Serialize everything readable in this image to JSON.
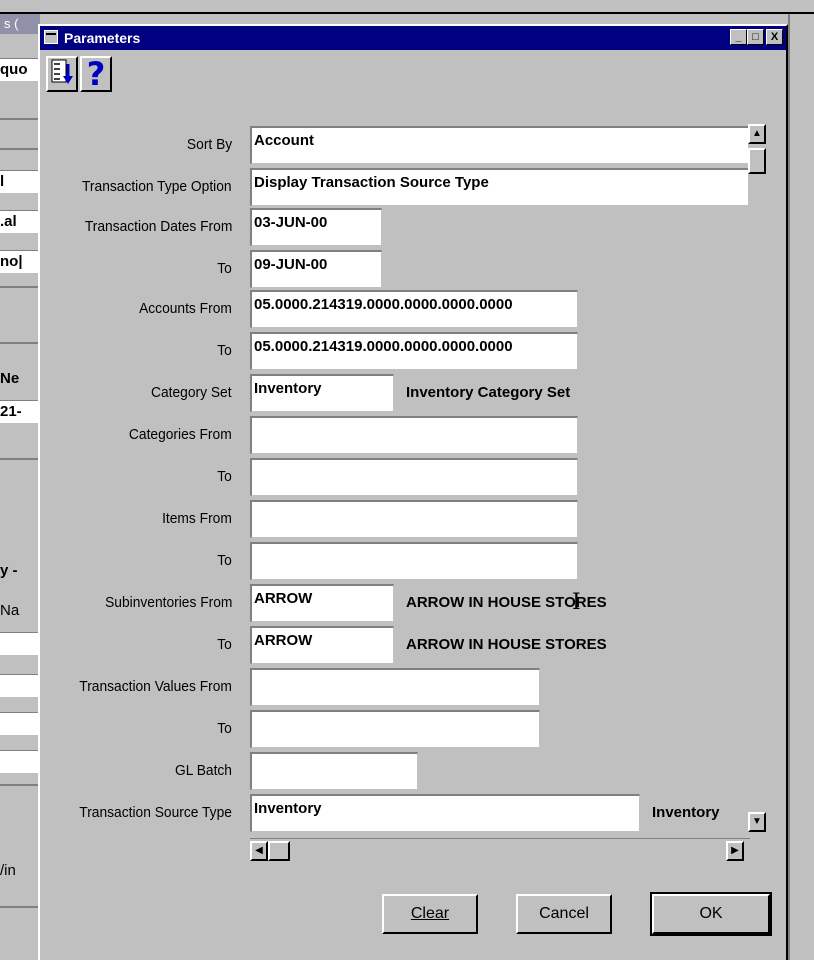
{
  "background_window": {
    "title_fragment": "s (",
    "fragments": [
      "quo",
      "l",
      ".al",
      "no|",
      "Ne",
      "21-",
      "y -",
      "Na",
      "/in"
    ]
  },
  "dialog": {
    "title": "Parameters",
    "window_buttons": {
      "minimize": "_",
      "maximize": "□",
      "close": "X"
    },
    "toolbar": {
      "sort_icon": "sort-order-icon",
      "help_label": "?"
    },
    "fields": [
      {
        "label": "Sort By",
        "value": "Account",
        "desc": ""
      },
      {
        "label": "Transaction Type Option",
        "value": "Display Transaction Source Type",
        "desc": ""
      },
      {
        "label": "Transaction Dates From",
        "value": "03-JUN-00",
        "desc": ""
      },
      {
        "label": "To",
        "value": "09-JUN-00",
        "desc": ""
      },
      {
        "label": "Accounts From",
        "value": "05.0000.214319.0000.0000.0000.0000",
        "desc": ""
      },
      {
        "label": "To",
        "value": "05.0000.214319.0000.0000.0000.0000",
        "desc": ""
      },
      {
        "label": "Category Set",
        "value": "Inventory",
        "desc": "Inventory Category Set"
      },
      {
        "label": "Categories From",
        "value": "",
        "desc": ""
      },
      {
        "label": "To",
        "value": "",
        "desc": ""
      },
      {
        "label": "Items From",
        "value": "",
        "desc": ""
      },
      {
        "label": "To",
        "value": "",
        "desc": ""
      },
      {
        "label": "Subinventories From",
        "value": "ARROW",
        "desc": "ARROW IN HOUSE STORES"
      },
      {
        "label": "To",
        "value": "ARROW",
        "desc": "ARROW IN HOUSE STORES"
      },
      {
        "label": "Transaction Values From",
        "value": "",
        "desc": ""
      },
      {
        "label": "To",
        "value": "",
        "desc": ""
      },
      {
        "label": "GL Batch",
        "value": "",
        "desc": ""
      },
      {
        "label": "Transaction Source Type",
        "value": "Inventory",
        "desc": "Inventory"
      }
    ],
    "buttons": {
      "clear": "Clear",
      "cancel": "Cancel",
      "ok": "OK"
    }
  }
}
